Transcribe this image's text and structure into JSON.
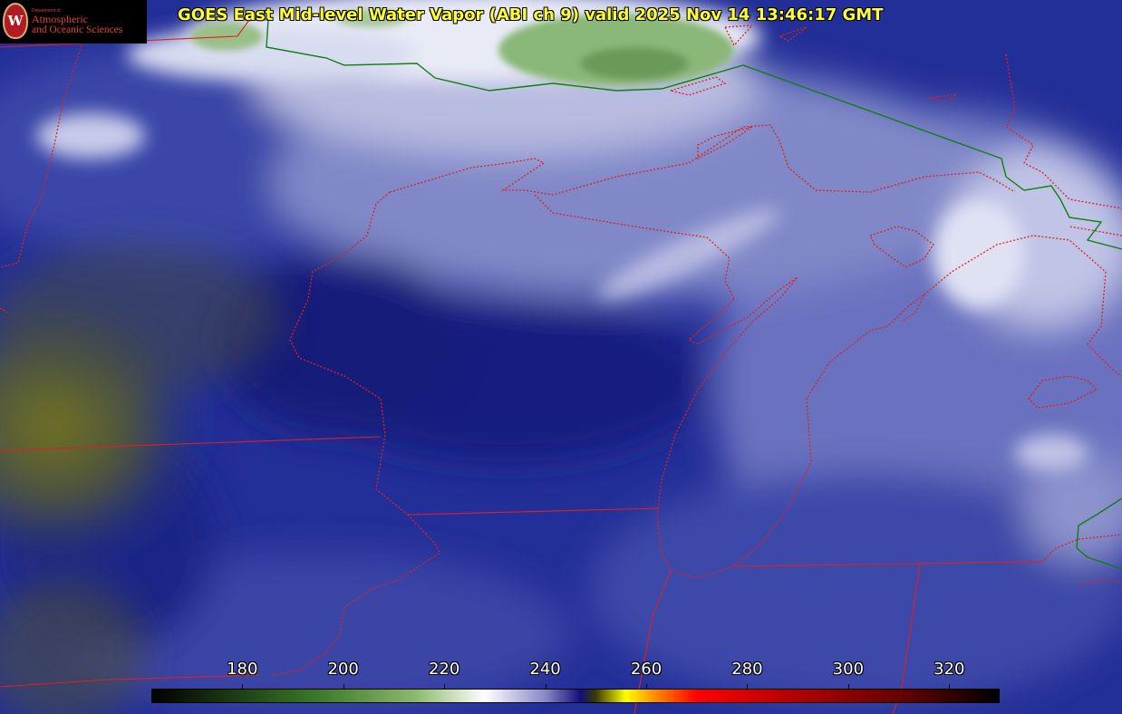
{
  "title": "GOES East Mid-level Water Vapor (ABI ch 9)  valid 2025 Nov 14 13:46:17 GMT",
  "logo": {
    "dept": "Department of",
    "line1": "Atmospheric",
    "line2": "and Oceanic Sciences",
    "seal_letter": "W",
    "icon": "uw-crest-icon"
  },
  "colorbar": {
    "min": 162,
    "max": 330,
    "ticks": [
      180,
      200,
      220,
      240,
      260,
      280,
      300,
      320
    ],
    "stops": [
      {
        "v": 162,
        "c": "#000000"
      },
      {
        "v": 195,
        "c": "#3a7a28"
      },
      {
        "v": 214,
        "c": "#8ab86a"
      },
      {
        "v": 228,
        "c": "#ffffff"
      },
      {
        "v": 240,
        "c": "#8888c8"
      },
      {
        "v": 247,
        "c": "#10107a"
      },
      {
        "v": 250,
        "c": "#3a3a00"
      },
      {
        "v": 256,
        "c": "#ffff00"
      },
      {
        "v": 262,
        "c": "#ff8800"
      },
      {
        "v": 270,
        "c": "#ff0000"
      },
      {
        "v": 290,
        "c": "#b00000"
      },
      {
        "v": 312,
        "c": "#600000"
      },
      {
        "v": 330,
        "c": "#000000"
      }
    ]
  },
  "colors": {
    "state_border": "#e02020",
    "intl_border": "#108010",
    "coast": "#e03030"
  }
}
